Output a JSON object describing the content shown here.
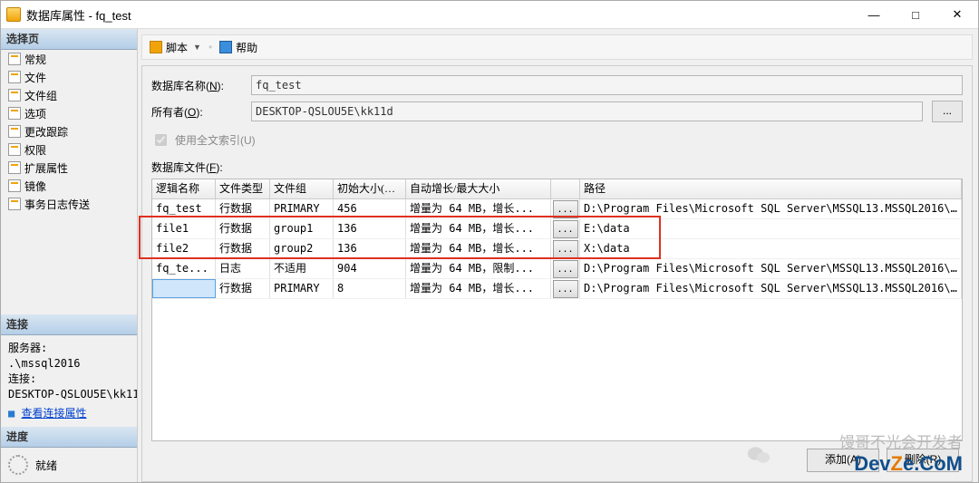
{
  "window": {
    "title": "数据库属性 - fq_test"
  },
  "selectPage": {
    "header": "选择页",
    "items": [
      "常规",
      "文件",
      "文件组",
      "选项",
      "更改跟踪",
      "权限",
      "扩展属性",
      "镜像",
      "事务日志传送"
    ]
  },
  "connection": {
    "header": "连接",
    "serverLabel": "服务器:",
    "serverValue": ".\\mssql2016",
    "connLabel": "连接:",
    "connValue": "DESKTOP-QSLOU5E\\kk11",
    "viewProps": "查看连接属性"
  },
  "progress": {
    "header": "进度",
    "status": "就绪"
  },
  "toolbar": {
    "script": "脚本",
    "help": "帮助"
  },
  "form": {
    "dbNameLabelPrefix": "数据库名称(",
    "dbNameAccel": "N",
    "dbNameLabelSuffix": "):",
    "dbNameValue": "fq_test",
    "ownerLabelPrefix": "所有者(",
    "ownerAccel": "O",
    "ownerLabelSuffix": "):",
    "ownerValue": "DESKTOP-QSLOU5E\\kk11d",
    "fulltextPrefix": "使用全文索引(",
    "fulltextAccel": "U",
    "fulltextSuffix": ")",
    "filesLabelPrefix": "数据库文件(",
    "filesAccel": "F",
    "filesLabelSuffix": "):",
    "browseBtn": "..."
  },
  "table": {
    "headers": {
      "logic": "逻辑名称",
      "type": "文件类型",
      "group": "文件组",
      "size": "初始大小(MB)",
      "grow": "自动增长/最大大小",
      "path": "路径"
    },
    "rows": [
      {
        "logic": "fq_test",
        "type": "行数据",
        "group": "PRIMARY",
        "size": "456",
        "grow": "增量为 64 MB，增长...",
        "growbtn": "...",
        "path": "D:\\Program Files\\Microsoft SQL Server\\MSSQL13.MSSQL2016\\MSSQ.."
      },
      {
        "logic": "file1",
        "type": "行数据",
        "group": "group1",
        "size": "136",
        "grow": "增量为 64 MB，增长...",
        "growbtn": "...",
        "path": "E:\\data"
      },
      {
        "logic": "file2",
        "type": "行数据",
        "group": "group2",
        "size": "136",
        "grow": "增量为 64 MB，增长...",
        "growbtn": "...",
        "path": "X:\\data"
      },
      {
        "logic": "fq_te...",
        "type": "日志",
        "group": "不适用",
        "size": "904",
        "grow": "增量为 64 MB，限制...",
        "growbtn": "...",
        "path": "D:\\Program Files\\Microsoft SQL Server\\MSSQL13.MSSQL2016\\MSSQ.."
      },
      {
        "logic": "",
        "type": "行数据",
        "group": "PRIMARY",
        "size": "8",
        "grow": "增量为 64 MB，增长...",
        "growbtn": "...",
        "path": "D:\\Program Files\\Microsoft SQL Server\\MSSQL13.MSSQL2016\\MSSQ.."
      }
    ]
  },
  "footer": {
    "add": "添加(A)",
    "remove": "删除(R)"
  },
  "watermark": {
    "cn": "馒哥不光会开发者",
    "dev1": "Dev",
    "devz": "Z",
    "dev2": "e.CoM"
  }
}
